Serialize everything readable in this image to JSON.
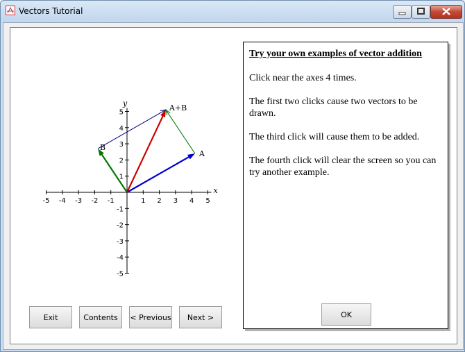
{
  "window": {
    "title": "Vectors Tutorial"
  },
  "chart_data": {
    "type": "vector-plot",
    "xlabel": "x",
    "ylabel": "y",
    "xlim": [
      -5,
      5
    ],
    "ylim": [
      -5,
      5
    ],
    "x_ticks": [
      "-5",
      "-4",
      "-3",
      "-2",
      "-1",
      "1",
      "2",
      "3",
      "4",
      "5"
    ],
    "y_ticks": [
      "5",
      "4",
      "3",
      "2",
      "1",
      "-1",
      "-2",
      "-3",
      "-4",
      "-5"
    ],
    "vectors": [
      {
        "label": "A",
        "from": [
          0,
          0
        ],
        "to": [
          4.2,
          2.4
        ],
        "color": "#0000cc"
      },
      {
        "label": "B",
        "from": [
          0,
          0
        ],
        "to": [
          -1.8,
          2.7
        ],
        "color": "#007700"
      },
      {
        "label": "A+B",
        "from": [
          0,
          0
        ],
        "to": [
          2.4,
          5.1
        ],
        "color": "#cc0000"
      }
    ],
    "parallelogram_edges": [
      {
        "from": [
          -1.8,
          2.7
        ],
        "to": [
          2.4,
          5.1
        ],
        "color": "#000080"
      },
      {
        "from": [
          4.2,
          2.4
        ],
        "to": [
          2.4,
          5.1
        ],
        "color": "#007700"
      }
    ]
  },
  "buttons": {
    "exit": "Exit",
    "contents": "Contents",
    "previous": "< Previous",
    "next": "Next >"
  },
  "info": {
    "heading": "Try your own examples of vector addition",
    "paragraphs": [
      "Click near the axes 4 times.",
      "The first two clicks cause two vectors to be drawn.",
      "The third click will cause them to be added.",
      "The fourth click will clear the screen so you can try another example."
    ],
    "ok": "OK"
  }
}
